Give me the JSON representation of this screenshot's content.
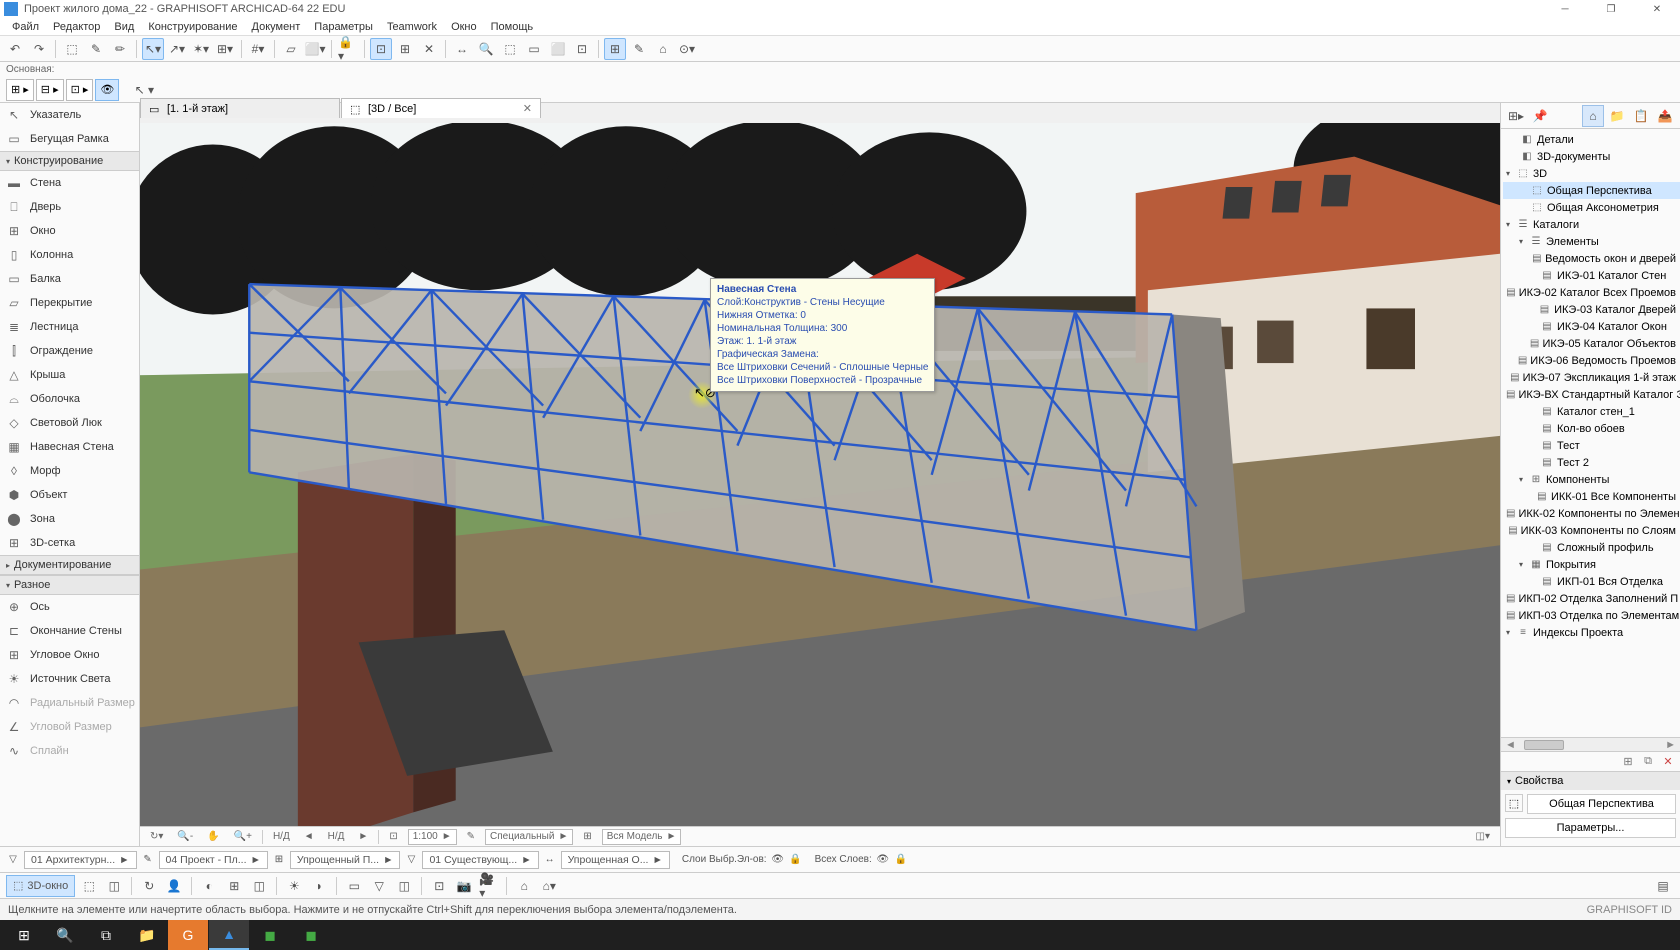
{
  "titlebar": {
    "title": "Проект жилого дома_22 - GRAPHISOFT ARCHICAD-64 22 EDU"
  },
  "menu": [
    "Файл",
    "Редактор",
    "Вид",
    "Конструирование",
    "Документ",
    "Параметры",
    "Teamwork",
    "Окно",
    "Помощь"
  ],
  "sublabel": "Основная:",
  "tool_palette": {
    "pointer": "Указатель",
    "marquee": "Бегущая Рамка",
    "header_design": "Конструирование",
    "wall": "Стена",
    "door": "Дверь",
    "window": "Окно",
    "column": "Колонна",
    "beam": "Балка",
    "slab": "Перекрытие",
    "stair": "Лестница",
    "railing": "Ограждение",
    "roof": "Крыша",
    "shell": "Оболочка",
    "skylight": "Световой Люк",
    "curtain_wall": "Навесная Стена",
    "morph": "Морф",
    "object": "Объект",
    "zone": "Зона",
    "mesh": "3D-сетка",
    "header_doc": "Документирование",
    "header_misc": "Разное",
    "axis": "Ось",
    "wall_end": "Окончание Стены",
    "corner_window": "Угловое Окно",
    "light": "Источник Света",
    "radial_dim": "Радиальный Размер",
    "angle_dim": "Угловой Размер",
    "spline": "Сплайн"
  },
  "tabs": {
    "plan": "[1. 1-й этаж]",
    "view3d": "[3D / Все]"
  },
  "tooltip": {
    "l1": "Навесная Стена",
    "l2": "Слой:Конструктив - Стены Несущие",
    "l3": "Нижняя Отметка: 0",
    "l4": "Номинальная Толщина: 300",
    "l5": "Этаж: 1. 1-й этаж",
    "l6": "Графическая Замена:",
    "l7": "Все Штриховки Сечений - Сплошные Черные",
    "l8": "Все Штриховки Поверхностей - Прозрачные"
  },
  "navigator": {
    "details": "Детали",
    "docs3d": "3D-документы",
    "n3d": "3D",
    "persp": "Общая Перспектива",
    "axo": "Общая Аксонометрия",
    "catalogs": "Каталоги",
    "elements": "Элементы",
    "el1": "Ведомость окон и дверей",
    "el2": "ИКЭ-01 Каталог Стен",
    "el3": "ИКЭ-02 Каталог Всех Проемов",
    "el4": "ИКЭ-03 Каталог Дверей",
    "el5": "ИКЭ-04 Каталог Окон",
    "el6": "ИКЭ-05 Каталог Объектов",
    "el7": "ИКЭ-06 Ведомость Проемов",
    "el8": "ИКЭ-07 Экспликация 1-й этаж",
    "el9": "ИКЭ-ВХ Стандартный Каталог Э",
    "el10": "Каталог стен_1",
    "el11": "Кол-во обоев",
    "el12": "Тест",
    "el13": "Тест 2",
    "components": "Компоненты",
    "c1": "ИКК-01 Все Компоненты",
    "c2": "ИКК-02 Компоненты по Элемен",
    "c3": "ИКК-03 Компоненты по Слоям",
    "c4": "Сложный профиль",
    "coverings": "Покрытия",
    "p1": "ИКП-01 Вся Отделка",
    "p2": "ИКП-02 Отделка Заполнений П",
    "p3": "ИКП-03 Отделка по Элементам",
    "proj_idx": "Индексы Проекта",
    "prop_header": "Свойства",
    "prop_persp": "Общая Перспектива",
    "prop_btn": "Параметры..."
  },
  "canvas_footer": {
    "nd1": "Н/Д",
    "nd2": "Н/Д",
    "scale": "1:100",
    "special": "Специальный",
    "model": "Вся Модель"
  },
  "qo_bar": {
    "arch": "01  Архитектурн...",
    "proj": "04  Проект - Пл...",
    "simp1": "Упрощенный П...",
    "exist": "01  Существующ...",
    "simp2": "Упрощенная О...",
    "sel_label": "Слои Выбр.Эл-ов:",
    "all_layers": "Всех Слоев:"
  },
  "bottom": {
    "win3d": "3D-окно"
  },
  "statusbar": {
    "hint": "Щелкните на элементе или начертите область выбора. Нажмите и не отпускайте Ctrl+Shift для переключения выбора элемента/подэлемента.",
    "brand": "GRAPHISOFT ID"
  }
}
